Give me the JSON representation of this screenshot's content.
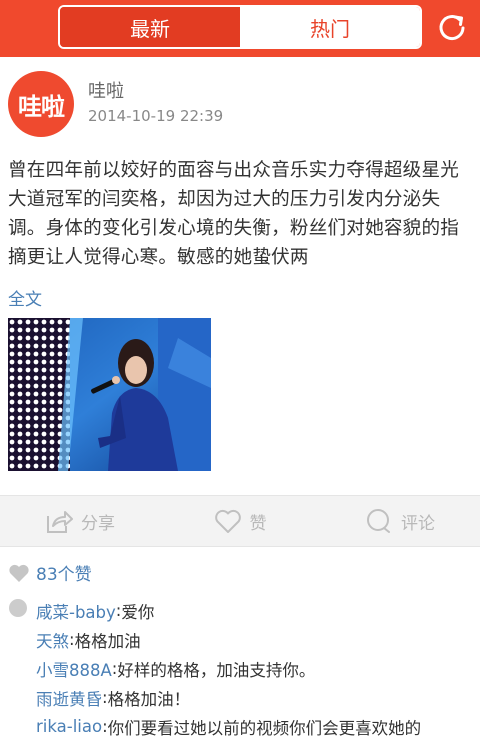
{
  "topbar": {
    "tabs": [
      {
        "label": "最新",
        "selected": false
      },
      {
        "label": "热门",
        "selected": true
      }
    ],
    "accent": "#f0492d"
  },
  "post": {
    "avatar_text": "哇啦",
    "author": "哇啦",
    "time": "2014-10-19 22:39",
    "text": "曾在四年前以姣好的面容与出众音乐实力夺得超级星光大道冠军的闫奕格，却因为过大的压力引发内分泌失调。身体的变化引发心境的失衡，粉丝们对她容貌的指摘更让人觉得心寒。敏感的她蛰伏两",
    "fulltext_link": "全文"
  },
  "actions": {
    "share": "分享",
    "like": "赞",
    "comment": "评论"
  },
  "likes": {
    "text": "83个赞"
  },
  "comments": [
    {
      "name": "咸菜-baby",
      "text": "爱你"
    },
    {
      "name": "天煞",
      "text": "格格加油"
    },
    {
      "name": "小雪888A",
      "text": "好样的格格，加油支持你。"
    },
    {
      "name": "雨逝黄昏",
      "text": "格格加油！"
    },
    {
      "name": "rika-liao",
      "text": "你们要看过她以前的视频你们会更喜欢她的"
    }
  ]
}
